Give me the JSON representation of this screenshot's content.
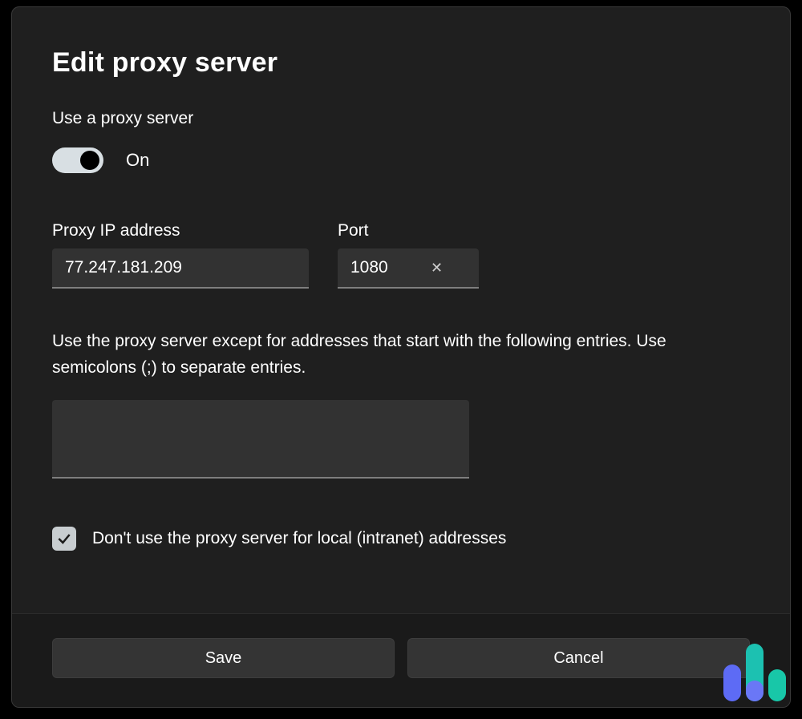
{
  "dialog": {
    "title": "Edit proxy server",
    "use_proxy_label": "Use a proxy server",
    "toggle_state": "On",
    "ip_label": "Proxy IP address",
    "ip_value": "77.247.181.209",
    "port_label": "Port",
    "port_value": "1080",
    "exceptions_desc": "Use the proxy server except for addresses that start with the following entries. Use semicolons (;) to separate entries.",
    "exceptions_value": "",
    "local_checkbox_label": "Don't use the proxy server for local (intranet) addresses",
    "local_checkbox_checked": true,
    "save_label": "Save",
    "cancel_label": "Cancel"
  }
}
